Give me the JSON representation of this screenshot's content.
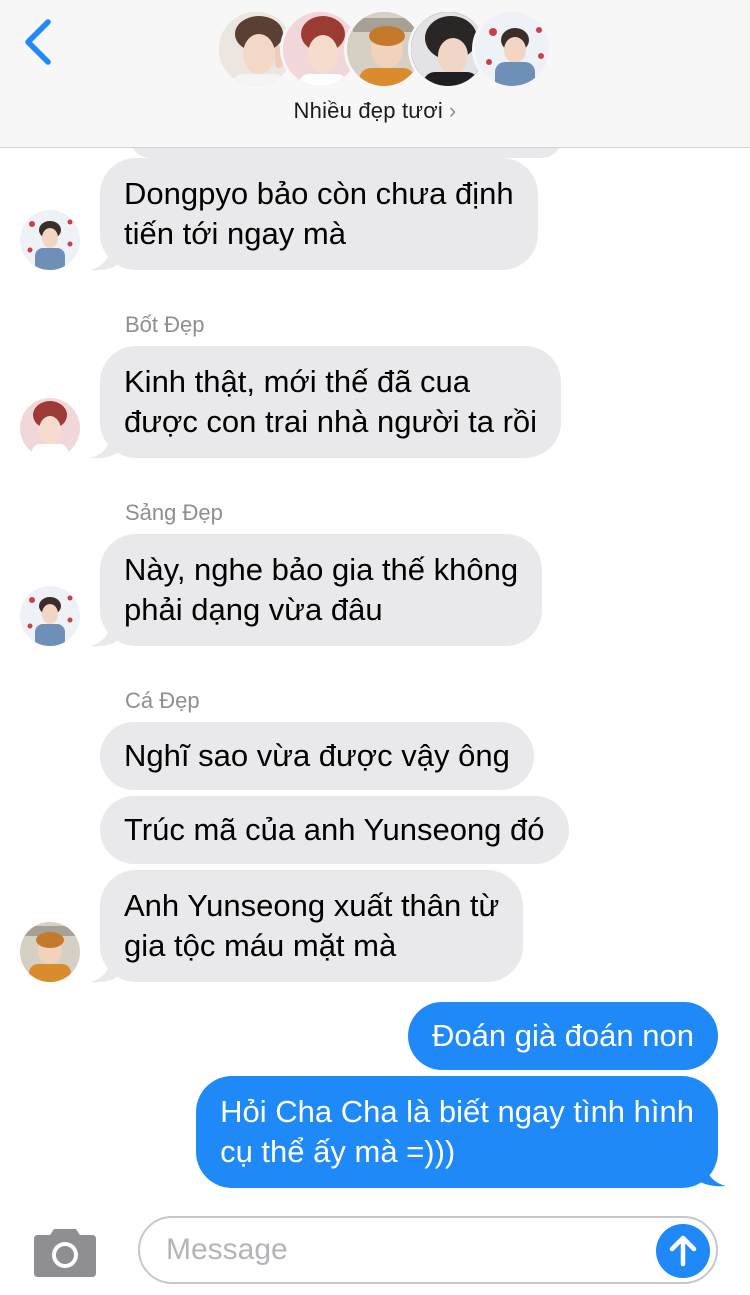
{
  "header": {
    "group_name": "Nhiều đẹp tươi",
    "chevron": "›",
    "back_icon": "chevron-left-icon",
    "avatar_count": 5
  },
  "messages": [
    {
      "sender": "",
      "text_lines": [
        "Dongpyo bảo còn chưa định",
        "tiến tới ngay mà"
      ],
      "direction": "incoming"
    },
    {
      "sender": "Bốt Đẹp",
      "text_lines": [
        "Kinh thật, mới thế đã cua",
        "được con trai nhà người ta rồi"
      ],
      "direction": "incoming"
    },
    {
      "sender": "Sảng Đẹp",
      "text_lines": [
        "Này, nghe bảo gia thế không",
        "phải dạng vừa đâu"
      ],
      "direction": "incoming"
    },
    {
      "sender": "Cá Đẹp",
      "text_lines": [
        "Nghĩ sao vừa được vậy ông"
      ],
      "direction": "incoming"
    },
    {
      "sender": "",
      "text_lines": [
        "Trúc mã của anh Yunseong đó"
      ],
      "direction": "incoming"
    },
    {
      "sender": "",
      "text_lines": [
        "Anh Yunseong xuất thân từ",
        "gia tộc máu mặt mà"
      ],
      "direction": "incoming"
    },
    {
      "sender": "",
      "text_lines": [
        "Đoán già đoán non"
      ],
      "direction": "outgoing"
    },
    {
      "sender": "",
      "text_lines": [
        "Hỏi Cha Cha là biết ngay tình hình",
        "cụ thể ấy mà =)))"
      ],
      "direction": "outgoing"
    }
  ],
  "composer": {
    "placeholder": "Message",
    "camera_icon": "camera-icon",
    "send_icon": "arrow-up-icon"
  },
  "colors": {
    "incoming_bubble": "#e9e9eb",
    "outgoing_bubble": "#1f8af7",
    "accent": "#1f8af7",
    "header_bg": "#f7f7f7"
  }
}
